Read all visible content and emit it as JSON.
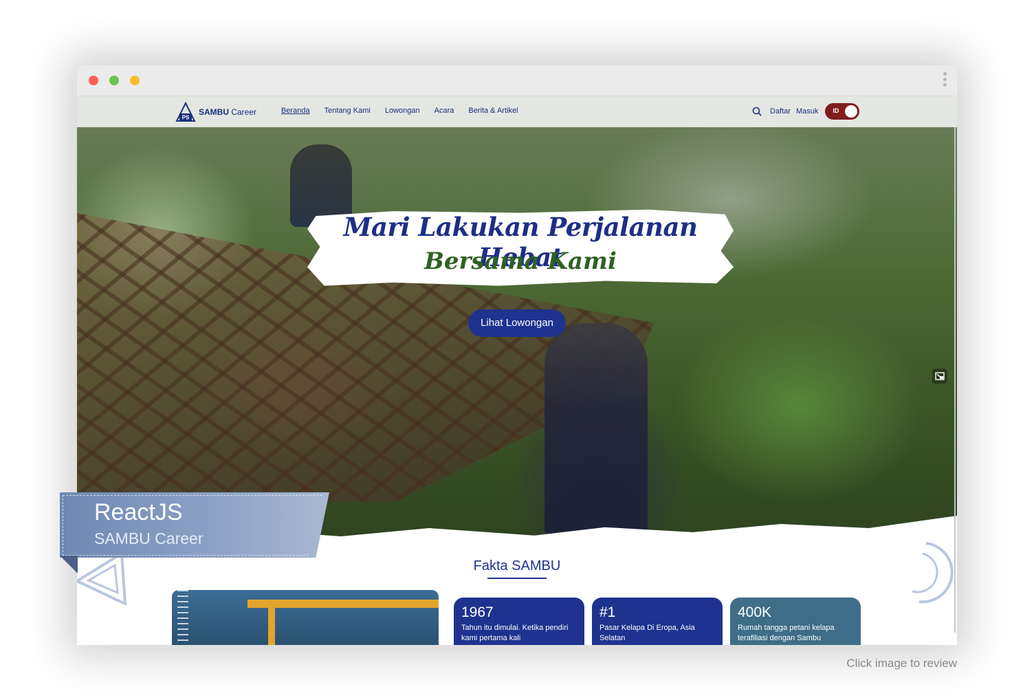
{
  "navbar": {
    "brand_bold": "SAMBU",
    "brand_rest": " Career",
    "links": [
      "Beranda",
      "Tentang Kami",
      "Lowongan",
      "Acara",
      "Berita & Artikel"
    ],
    "active_link": "Beranda",
    "register": "Daftar",
    "login": "Masuk",
    "language": "ID"
  },
  "hero": {
    "headline_line1": "Mari Lakukan Perjalanan Hebat",
    "headline_line2": "Bersama Kami",
    "cta_label": "Lihat Lowongan"
  },
  "facts": {
    "title_prefix": "Fakta ",
    "title_highlight": "SAMBU",
    "cards": [
      {
        "number": "1967",
        "description": "Tahun itu dimulai. Ketika pendiri kami pertama kali"
      },
      {
        "number": "#1",
        "description": "Pasar Kelapa Di Eropa, Asia Selatan"
      },
      {
        "number": "400K",
        "description": "Rumah tangga petani kelapa terafiliasi dengan Sambu"
      }
    ]
  },
  "ribbon": {
    "title": "ReactJS",
    "subtitle": "SAMBU Career"
  },
  "footer_note": "Click image to review",
  "colors": {
    "brand_navy": "#1e338f",
    "headline_green": "#2e6223",
    "toggle_bg": "#7f1d1d",
    "card_teal": "#3e6e87"
  },
  "icons": [
    "search-icon",
    "pip-icon",
    "logo-icon"
  ]
}
